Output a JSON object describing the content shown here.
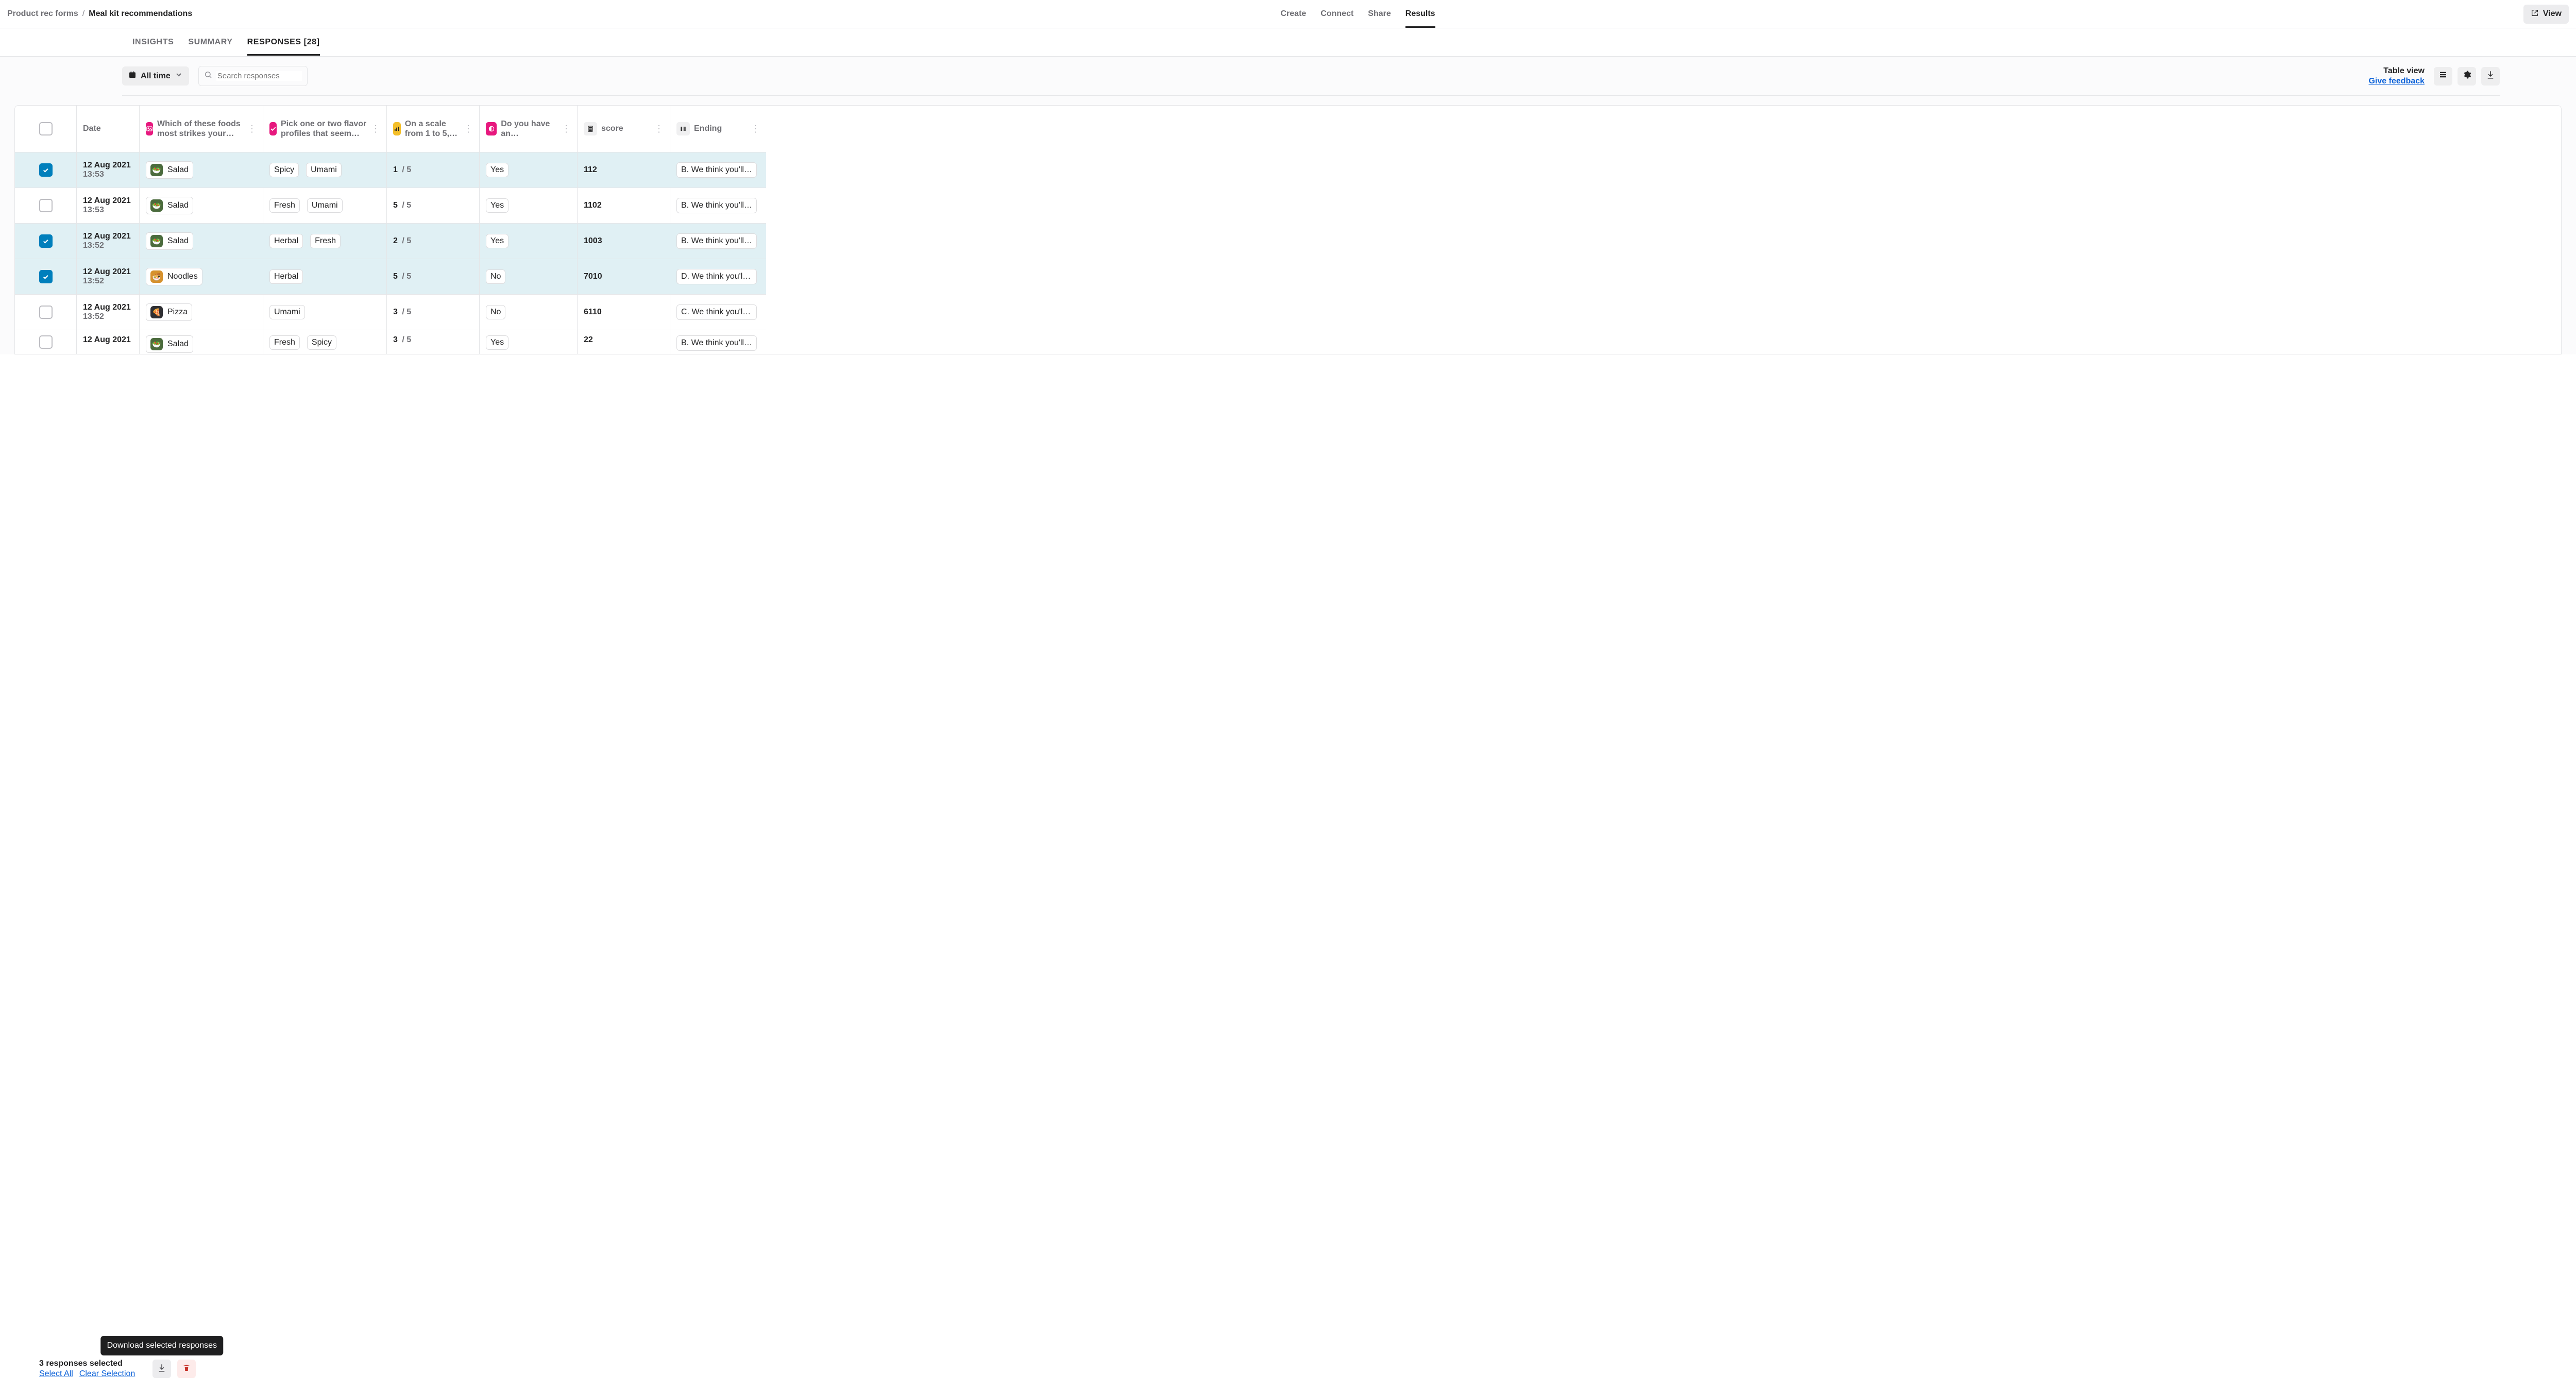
{
  "breadcrumb": {
    "parent": "Product rec forms",
    "sep": "/",
    "current": "Meal kit recommendations"
  },
  "topnav": {
    "create": "Create",
    "connect": "Connect",
    "share": "Share",
    "results": "Results"
  },
  "view_btn": "View",
  "subnav": {
    "insights": "INSIGHTS",
    "summary": "SUMMARY",
    "responses": "RESPONSES [28]"
  },
  "toolbar": {
    "time_label": "All time",
    "search_placeholder": "Search responses",
    "table_view_title": "Table view",
    "feedback": "Give feedback"
  },
  "columns": {
    "c1": "Date",
    "c2": "Which of these foods most strikes your…",
    "c3": "Pick one or two flavor profiles that seem…",
    "c4": "On a scale from 1 to 5,…",
    "c5": "Do you have an…",
    "c6": "score",
    "c7": "Ending"
  },
  "rows": [
    {
      "selected": true,
      "date": "12 Aug 2021",
      "time": "13:53",
      "food": "Salad",
      "foodClass": "salad",
      "flavors": [
        "Spicy",
        "Umami"
      ],
      "scale": "1",
      "max": "5",
      "choice": "Yes",
      "score": "112",
      "ending": "B. We think you'll lo"
    },
    {
      "selected": false,
      "date": "12 Aug 2021",
      "time": "13:53",
      "food": "Salad",
      "foodClass": "salad",
      "flavors": [
        "Fresh",
        "Umami"
      ],
      "scale": "5",
      "max": "5",
      "choice": "Yes",
      "score": "1102",
      "ending": "B. We think you'll lo"
    },
    {
      "selected": true,
      "date": "12 Aug 2021",
      "time": "13:52",
      "food": "Salad",
      "foodClass": "salad",
      "flavors": [
        "Herbal",
        "Fresh"
      ],
      "scale": "2",
      "max": "5",
      "choice": "Yes",
      "score": "1003",
      "ending": "B. We think you'll lo"
    },
    {
      "selected": true,
      "date": "12 Aug 2021",
      "time": "13:52",
      "food": "Noodles",
      "foodClass": "noodles",
      "flavors": [
        "Herbal"
      ],
      "scale": "5",
      "max": "5",
      "choice": "No",
      "score": "7010",
      "ending": "D. We think you'll lo"
    },
    {
      "selected": false,
      "date": "12 Aug 2021",
      "time": "13:52",
      "food": "Pizza",
      "foodClass": "pizza",
      "flavors": [
        "Umami"
      ],
      "scale": "3",
      "max": "5",
      "choice": "No",
      "score": "6110",
      "ending": "C. We think you'll lo"
    },
    {
      "selected": false,
      "date": "12 Aug 2021",
      "time": "",
      "food": "Salad",
      "foodClass": "salad",
      "flavors": [
        "Fresh",
        "Spicy"
      ],
      "scale": "3",
      "max": "5",
      "choice": "Yes",
      "score": "22",
      "ending": "B. We think you'll lo"
    }
  ],
  "footer": {
    "selected_text": "3 responses selected",
    "select_all": "Select All",
    "clear": "Clear Selection",
    "tooltip": "Download selected responses"
  }
}
